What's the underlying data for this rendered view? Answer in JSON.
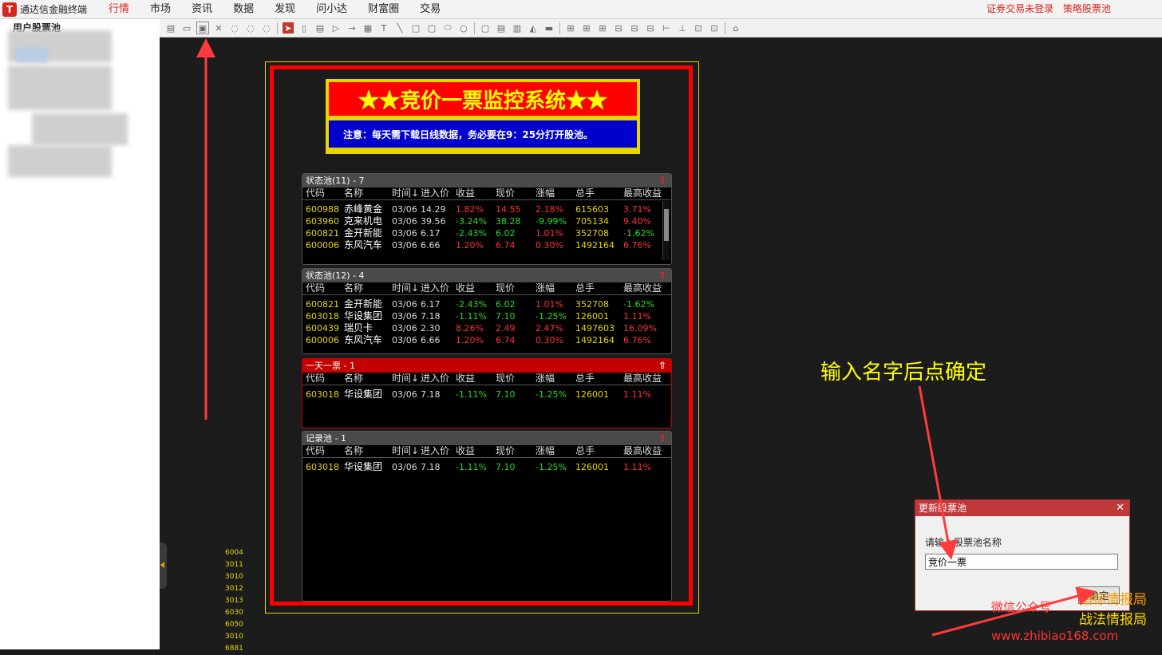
{
  "app": {
    "name": "通达信金融终端",
    "logo_glyph": "T"
  },
  "menu": {
    "items": [
      "行情",
      "市场",
      "资讯",
      "数据",
      "发现",
      "问小达",
      "财富圈",
      "交易"
    ],
    "active": "行情",
    "right": [
      "证券交易未登录",
      "策略股票池"
    ]
  },
  "left_panel": {
    "tree_title": "用户股票池"
  },
  "toolbar": {
    "icons": [
      "new-icon",
      "open-icon",
      "save-icon",
      "delete-icon",
      "play-icon",
      "pause-icon",
      "stop-icon",
      "pointer-icon",
      "round-rect-icon",
      "page-icon",
      "triangle-icon",
      "arrow-icon",
      "grid-icon",
      "text-icon",
      "line-icon",
      "rect-icon",
      "rounded-rect-icon",
      "ellipse-icon",
      "circle-icon",
      "copy-icon",
      "paste-icon",
      "trash-icon",
      "fill-icon",
      "align-icon",
      "align-left-icon",
      "align-center-icon",
      "align-right-icon",
      "align-top-icon",
      "align-middle-icon",
      "align-bottom-icon",
      "distribute-h-icon",
      "distribute-v-icon",
      "same-width-icon",
      "same-height-icon",
      "bank-icon"
    ]
  },
  "banner": {
    "title": "★★竞价一票监控系统★★",
    "note": "注意：每天需下载日线数据，务必要在9：25分打开股池。"
  },
  "columns": [
    "代码",
    "名称",
    "时间↓",
    "进入价",
    "收益",
    "现价",
    "涨幅",
    "总手",
    "最高收益"
  ],
  "pools": [
    {
      "title": "状态池(11) - 7",
      "rows": [
        {
          "code": "600988",
          "name": "赤峰黄金",
          "time": "03/06",
          "price": "14.29",
          "gain": "1.82%",
          "cur": "14.55",
          "chg": "2.18%",
          "vol": "615603",
          "max": "3.71%",
          "gain_dir": "up",
          "chg_dir": "up",
          "max_dir": "up"
        },
        {
          "code": "603960",
          "name": "克来机电",
          "time": "03/06",
          "price": "39.56",
          "gain": "-3.24%",
          "cur": "38.28",
          "chg": "-9.99%",
          "vol": "705134",
          "max": "9.40%",
          "gain_dir": "down",
          "chg_dir": "down",
          "max_dir": "up"
        },
        {
          "code": "600821",
          "name": "金开新能",
          "time": "03/06",
          "price": "6.17",
          "gain": "-2.43%",
          "cur": "6.02",
          "chg": "1.01%",
          "vol": "352708",
          "max": "-1.62%",
          "gain_dir": "down",
          "chg_dir": "up",
          "max_dir": "down"
        },
        {
          "code": "600006",
          "name": "东风汽车",
          "time": "03/06",
          "price": "6.66",
          "gain": "1.20%",
          "cur": "6.74",
          "chg": "0.30%",
          "vol": "1492164",
          "max": "6.76%",
          "gain_dir": "up",
          "chg_dir": "up",
          "max_dir": "up"
        }
      ]
    },
    {
      "title": "状态池(12) - 4",
      "rows": [
        {
          "code": "600821",
          "name": "金开新能",
          "time": "03/06",
          "price": "6.17",
          "gain": "-2.43%",
          "cur": "6.02",
          "chg": "1.01%",
          "vol": "352708",
          "max": "-1.62%",
          "gain_dir": "down",
          "chg_dir": "up",
          "max_dir": "down"
        },
        {
          "code": "603018",
          "name": "华设集团",
          "time": "03/06",
          "price": "7.18",
          "gain": "-1.11%",
          "cur": "7.10",
          "chg": "-1.25%",
          "vol": "126001",
          "max": "1.11%",
          "gain_dir": "down",
          "chg_dir": "down",
          "max_dir": "up"
        },
        {
          "code": "600439",
          "name": "瑞贝卡",
          "time": "03/06",
          "price": "2.30",
          "gain": "8.26%",
          "cur": "2.49",
          "chg": "2.47%",
          "vol": "1497603",
          "max": "16.09%",
          "gain_dir": "up",
          "chg_dir": "up",
          "max_dir": "up"
        },
        {
          "code": "600006",
          "name": "东风汽车",
          "time": "03/06",
          "price": "6.66",
          "gain": "1.20%",
          "cur": "6.74",
          "chg": "0.30%",
          "vol": "1492164",
          "max": "6.76%",
          "gain_dir": "up",
          "chg_dir": "up",
          "max_dir": "up"
        }
      ]
    },
    {
      "title": "一天一票 - 1",
      "rows": [
        {
          "code": "603018",
          "name": "华设集团",
          "time": "03/06",
          "price": "7.18",
          "gain": "-1.11%",
          "cur": "7.10",
          "chg": "-1.25%",
          "vol": "126001",
          "max": "1.11%",
          "gain_dir": "down",
          "chg_dir": "down",
          "max_dir": "up"
        }
      ]
    },
    {
      "title": "记录池 - 1",
      "rows": [
        {
          "code": "603018",
          "name": "华设集团",
          "time": "03/06",
          "price": "7.18",
          "gain": "-1.11%",
          "cur": "7.10",
          "chg": "-1.25%",
          "vol": "126001",
          "max": "1.11%",
          "gain_dir": "down",
          "chg_dir": "down",
          "max_dir": "up"
        }
      ]
    }
  ],
  "side_codes": [
    "6004",
    "3011",
    "3010",
    "3012",
    "3013",
    "6030",
    "6050",
    "3010",
    "6881"
  ],
  "dialog": {
    "title": "更新股票池",
    "label": "请输入股票池名称",
    "value": "竞价一票",
    "ok": "确定",
    "close": "✕"
  },
  "annotation": {
    "text": "输入名字后点确定"
  },
  "watermark": {
    "line1": "指标情报局",
    "line2": "战法情报局",
    "line3": "微信公众号",
    "line4": "www.zhibiao168.com"
  },
  "colors": {
    "up": "#ff3030",
    "down": "#22dd22",
    "accent": "#d7261e",
    "highlight": "#ffff00"
  }
}
